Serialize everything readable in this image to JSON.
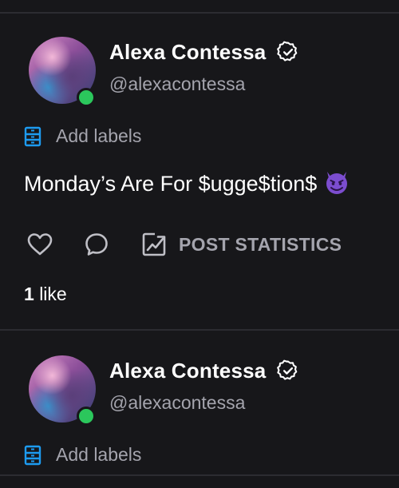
{
  "posts": [
    {
      "author_name": "Alexa Contessa",
      "author_handle": "@alexacontessa",
      "labels_text": "Add labels",
      "text": "Monday’s Are For $ugge$tion$",
      "stats_label": "POST STATISTICS",
      "likes_count": "1",
      "likes_label": "like",
      "online": true,
      "verified": true,
      "emoji": "smiling-devil-icon"
    },
    {
      "author_name": "Alexa Contessa",
      "author_handle": "@alexacontessa",
      "labels_text": "Add labels",
      "online": true,
      "verified": true
    }
  ],
  "colors": {
    "background": "#17171a",
    "accent": "#1d9bf0",
    "online": "#2bc75c",
    "secondary_text": "#a4a4ad",
    "emoji": "#7c4dcf"
  }
}
